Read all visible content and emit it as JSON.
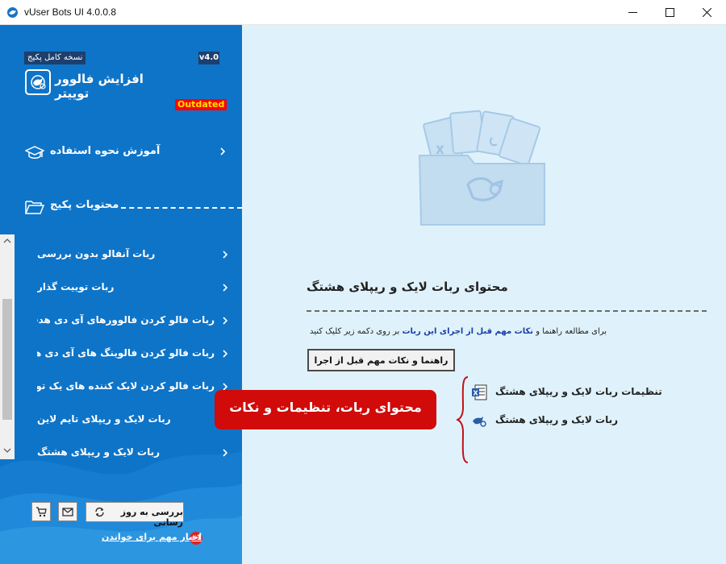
{
  "window": {
    "title": "vUser Bots UI 4.0.0.8"
  },
  "sidebar": {
    "version_badge": "v4.0",
    "package_label": "نسخه کامل پکیج",
    "app_name": "افزایش فالوور توییتر",
    "status_badge": "Outdated",
    "tutorial_label": "آموزش نحوه استفاده",
    "package_contents_label": "محتویات پکیج",
    "items": [
      {
        "label": "ربات آنفالو بدون بررسی"
      },
      {
        "label": "ربات توییت گذار"
      },
      {
        "label": "ربات فالو کردن فالوورهای آی دی هدف"
      },
      {
        "label": "ربات فالو کردن فالوینگ های آی دی هدف"
      },
      {
        "label": "ربات فالو کردن لایک کننده های یک توییت"
      },
      {
        "label": "ربات لایک و ریپلای تایم لاین"
      },
      {
        "label": "ربات لایک و ریپلای هشتگ"
      }
    ],
    "update_button": "بررسی به روز رسانی",
    "news_count": "+1",
    "news_link": "اخبار مهم برای خواندن"
  },
  "main": {
    "title": "محتوای ربات لایک و ریپلای هشتگ",
    "description_prefix": "برای مطالعه راهنما و",
    "description_highlight": "نکات مهم قبل از اجرای این ربات",
    "description_suffix": "بر روی دکمه زیر کلیک کنید",
    "guide_button": "راهنما و نکات مهم قبل از اجرا",
    "files": [
      {
        "label": "تنظیمات ربات لایک و ریپلای هشتگ",
        "icon": "excel-icon"
      },
      {
        "label": "ربات لایک و ریپلای هشتگ",
        "icon": "bot-icon"
      }
    ],
    "callout": "محتوای ربات، تنظیمات و نکات"
  },
  "colors": {
    "sidebar": "#0e74c8",
    "main_bg": "#dff2fb",
    "callout": "#d10a0a",
    "outdated_bg": "#ff0000",
    "outdated_text": "#ffe400"
  }
}
